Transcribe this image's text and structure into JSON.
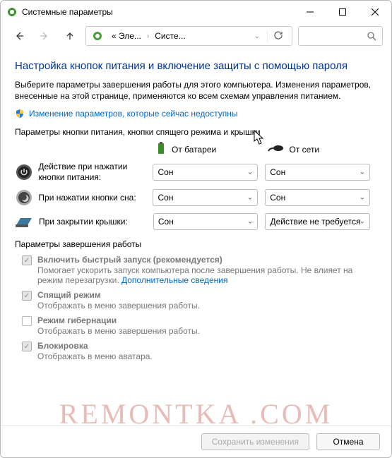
{
  "window": {
    "title": "Системные параметры"
  },
  "breadcrumb": {
    "root_label": "« Эле...",
    "current": "Систе..."
  },
  "page": {
    "heading": "Настройка кнопок питания и включение защиты с помощью пароля",
    "intro": "Выберите параметры завершения работы для этого компьютера. Изменения параметров, внесенные на этой странице, применяются ко всем схемам управления питанием.",
    "change_link": "Изменение параметров, которые сейчас недоступны",
    "buttons_section": "Параметры кнопки питания, кнопки спящего режима и крышки",
    "col_battery": "От батареи",
    "col_ac": "От сети",
    "rows": [
      {
        "label": "Действие при нажатии кнопки питания:",
        "battery": "Сон",
        "ac": "Сон"
      },
      {
        "label": "При нажатии кнопки сна:",
        "battery": "Сон",
        "ac": "Сон"
      },
      {
        "label": "При закрытии крышки:",
        "battery": "Сон",
        "ac": "Действие не требуется"
      }
    ],
    "shutdown_section": "Параметры завершения работы",
    "shutdown_opts": [
      {
        "title": "Включить быстрый запуск (рекомендуется)",
        "desc": "Помогает ускорить запуск компьютера после завершения работы. Не влияет на режим перезагрузки. ",
        "link": "Дополнительные сведения",
        "checked": true
      },
      {
        "title": "Спящий режим",
        "desc": "Отображать в меню завершения работы.",
        "checked": true
      },
      {
        "title": "Режим гибернации",
        "desc": "Отображать в меню завершения работы.",
        "checked": false
      },
      {
        "title": "Блокировка",
        "desc": "Отображать в меню аватара.",
        "checked": true
      }
    ]
  },
  "footer": {
    "save": "Сохранить изменения",
    "cancel": "Отмена"
  },
  "watermark": "REMONTKA .COM"
}
